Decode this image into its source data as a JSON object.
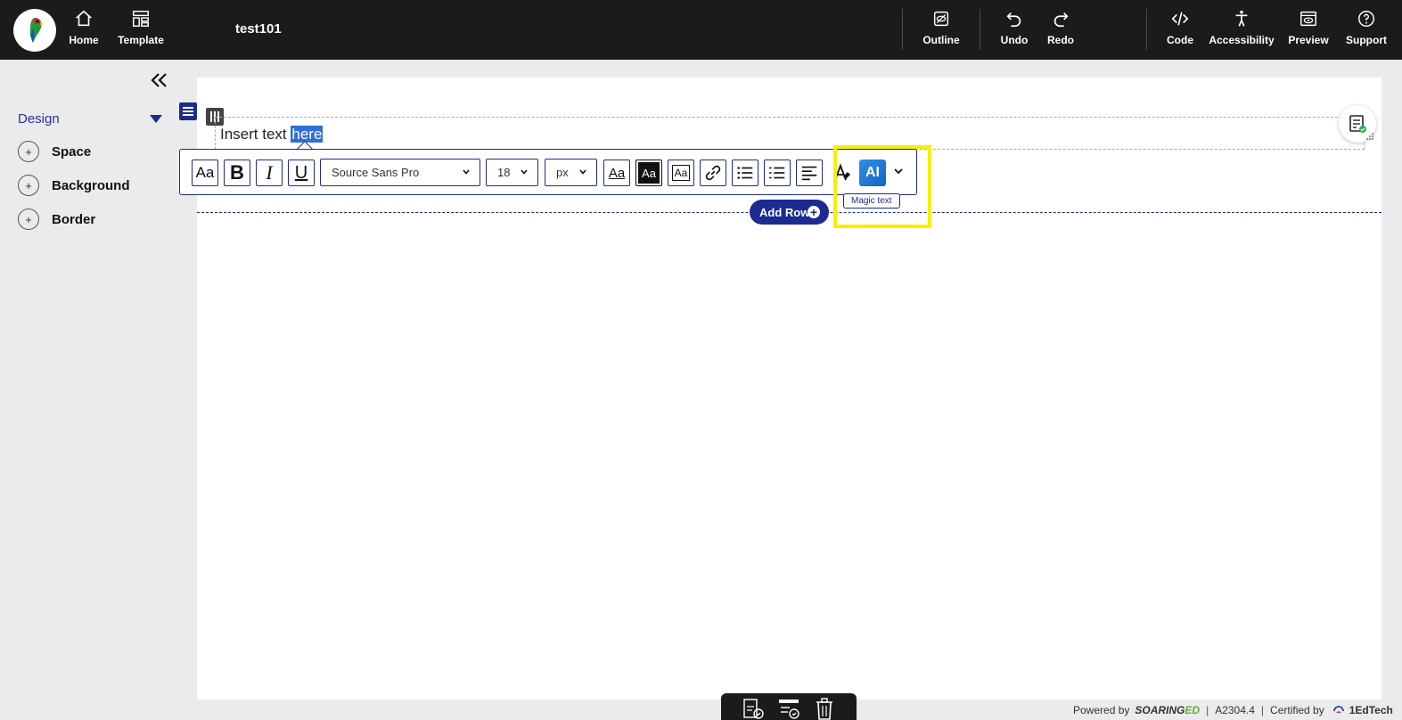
{
  "app": {
    "doc_title": "test101",
    "nav_left": [
      {
        "label": "Home",
        "icon": "home-icon"
      },
      {
        "label": "Template",
        "icon": "template-icon"
      }
    ],
    "nav_right": [
      {
        "label": "Outline",
        "icon": "outline-icon"
      },
      {
        "label": "Undo",
        "icon": "undo-icon"
      },
      {
        "label": "Redo",
        "icon": "redo-icon"
      },
      {
        "label": "Code",
        "icon": "code-icon"
      },
      {
        "label": "Accessibility",
        "icon": "accessibility-icon"
      },
      {
        "label": "Preview",
        "icon": "preview-icon"
      },
      {
        "label": "Support",
        "icon": "help-icon"
      }
    ]
  },
  "sidebar": {
    "section_label": "Design",
    "items": [
      {
        "label": "Space"
      },
      {
        "label": "Background"
      },
      {
        "label": "Border"
      }
    ]
  },
  "editor": {
    "text_before": "Insert text ",
    "text_selected": "here",
    "toolbar": {
      "font_case": "Aa",
      "bold": "B",
      "italic": "I",
      "underline": "U",
      "font_family": "Source Sans Pro",
      "font_size": "18",
      "font_unit": "px",
      "text_style_1": "Aa",
      "text_style_2": "Aa",
      "text_style_3": "Aa",
      "ai_label": "AI"
    },
    "tooltip": "Magic text",
    "add_row": "Add Row"
  },
  "footer": {
    "powered_by": "Powered by",
    "brand_a": "SOARING",
    "brand_b": "ED",
    "version": "A2304.4",
    "certified_by": "Certified by",
    "cert_org": "1EdTech"
  },
  "colors": {
    "topbar": "#1b1b1b",
    "accent": "#1c2b8f",
    "selection": "#2e6fd8",
    "highlight_box": "#f7f000"
  }
}
